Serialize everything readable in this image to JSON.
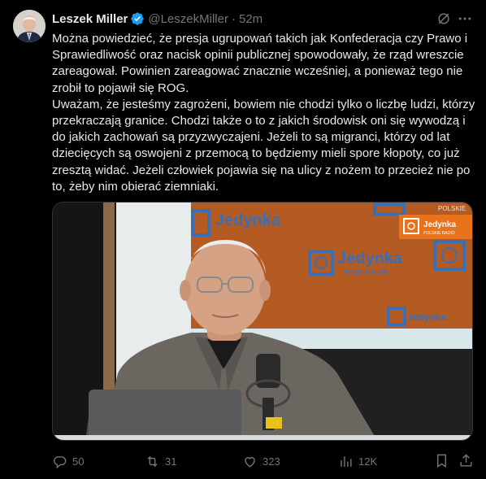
{
  "author": {
    "name": "Leszek Miller",
    "handle": "@LeszekMiller",
    "separator": "·",
    "time": "52m"
  },
  "tweet": {
    "text": "Można powiedzieć, że presja ugrupowań takich jak Konfederacja czy Prawo i Sprawiedliwość oraz nacisk opinii publicznej spowodowały, że rząd wreszcie zareagował. Powinien zareagować znacznie wcześniej, a ponieważ tego nie zrobił to pojawił się ROG.\nUważam, że jesteśmy zagrożeni, bowiem nie chodzi tylko o liczbę ludzi, którzy przekraczają granice. Chodzi także o to z jakich środowisk oni się wywodzą i do jakich zachowań są przyzwyczajeni. Jeżeli to są migranci, którzy od lat dziecięcych są oswojeni z przemocą to będziemy mieli spore kłopoty, co już zresztą widać. Jeżeli człowiek pojawia się na ulicy z nożem to przecież nie po to, żeby nim obierać ziemniaki."
  },
  "media": {
    "brand": "Jedynka",
    "brand_sub": "POLSKIE RADIO",
    "corner_label": "POLSKIE",
    "accent": "#e8731a"
  },
  "actions": {
    "replies": "50",
    "reposts": "31",
    "likes": "323",
    "views": "12K"
  },
  "colors": {
    "background": "#000000",
    "text": "#e7e9ea",
    "secondary": "#71767b",
    "verified": "#1d9bf0"
  },
  "icons": [
    "verified-badge-icon",
    "grok-icon",
    "more-icon",
    "reply-icon",
    "repost-icon",
    "like-icon",
    "views-icon",
    "bookmark-icon",
    "share-icon"
  ]
}
